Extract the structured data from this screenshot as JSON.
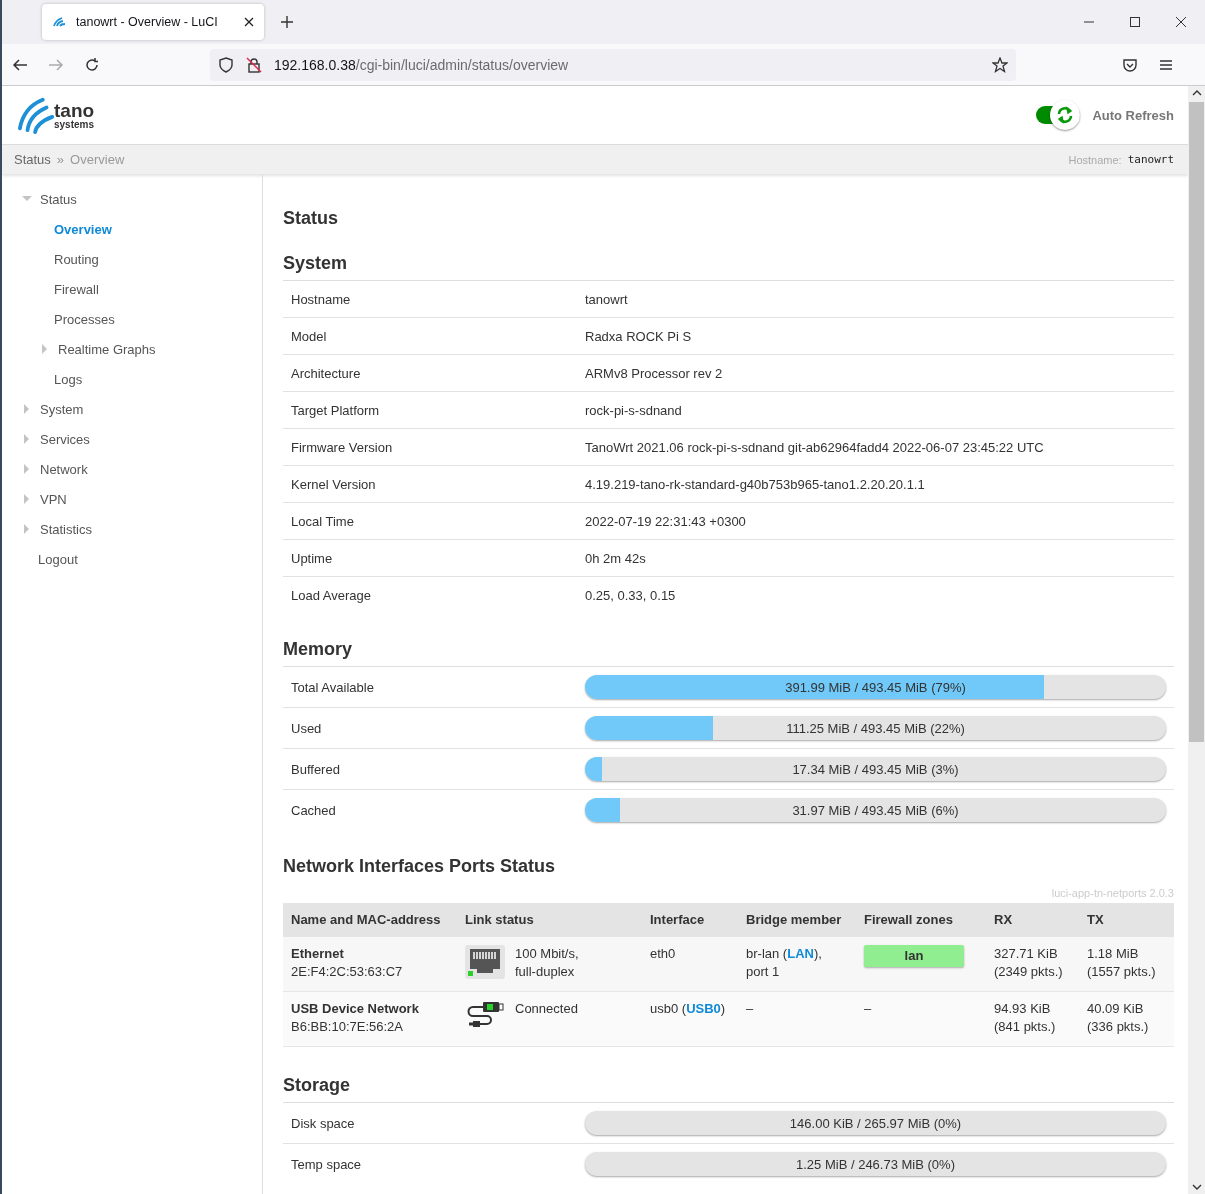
{
  "browser": {
    "tab_title": "tanowrt - Overview - LuCI",
    "url_host": "192.168.0.38",
    "url_path": "/cgi-bin/luci/admin/status/overview"
  },
  "header": {
    "logo_main": "tano",
    "logo_sub": "systems",
    "auto_refresh": {
      "label": "Auto Refresh",
      "on": true
    }
  },
  "breadcrumb": {
    "items": [
      "Status",
      "Overview"
    ],
    "separator": "»",
    "hostname_label": "Hostname:",
    "hostname": "tanowrt"
  },
  "sidebar": {
    "items": [
      {
        "label": "Status",
        "kind": "folder",
        "expanded": true,
        "selected": false,
        "children": [
          {
            "label": "Overview",
            "kind": "link",
            "selected": true
          },
          {
            "label": "Routing",
            "kind": "link",
            "selected": false
          },
          {
            "label": "Firewall",
            "kind": "link",
            "selected": false
          },
          {
            "label": "Processes",
            "kind": "link",
            "selected": false
          },
          {
            "label": "Realtime Graphs",
            "kind": "folder",
            "expanded": false,
            "selected": false
          },
          {
            "label": "Logs",
            "kind": "link",
            "selected": false
          }
        ]
      },
      {
        "label": "System",
        "kind": "folder",
        "expanded": false,
        "selected": false
      },
      {
        "label": "Services",
        "kind": "folder",
        "expanded": false,
        "selected": false
      },
      {
        "label": "Network",
        "kind": "folder",
        "expanded": false,
        "selected": false
      },
      {
        "label": "VPN",
        "kind": "folder",
        "expanded": false,
        "selected": false
      },
      {
        "label": "Statistics",
        "kind": "folder",
        "expanded": false,
        "selected": false
      },
      {
        "label": "Logout",
        "kind": "link",
        "selected": false
      }
    ]
  },
  "page_title": "Status",
  "system": {
    "title": "System",
    "rows": [
      {
        "label": "Hostname",
        "value": "tanowrt"
      },
      {
        "label": "Model",
        "value": "Radxa ROCK Pi S"
      },
      {
        "label": "Architecture",
        "value": "ARMv8 Processor rev 2"
      },
      {
        "label": "Target Platform",
        "value": "rock-pi-s-sdnand"
      },
      {
        "label": "Firmware Version",
        "value": "TanoWrt 2021.06 rock-pi-s-sdnand git-ab62964fadd4 2022-06-07 23:45:22 UTC"
      },
      {
        "label": "Kernel Version",
        "value": "4.19.219-tano-rk-standard-g40b753b965-tano1.2.20.20.1.1"
      },
      {
        "label": "Local Time",
        "value": "2022-07-19 22:31:43 +0300"
      },
      {
        "label": "Uptime",
        "value": "0h 2m 42s"
      },
      {
        "label": "Load Average",
        "value": "0.25, 0.33, 0.15"
      }
    ]
  },
  "memory": {
    "title": "Memory",
    "rows": [
      {
        "label": "Total Available",
        "reading": "391.99 MiB / 493.45 MiB (79%)",
        "level": 0.79
      },
      {
        "label": "Used",
        "reading": "111.25 MiB / 493.45 MiB (22%)",
        "level": 0.22
      },
      {
        "label": "Buffered",
        "reading": "17.34 MiB / 493.45 MiB (3%)",
        "level": 0.03
      },
      {
        "label": "Cached",
        "reading": "31.97 MiB / 493.45 MiB (6%)",
        "level": 0.06
      }
    ]
  },
  "ports": {
    "title": "Network Interfaces Ports Status",
    "version": "luci-app-tn-netports 2.0.3",
    "columns": [
      "Name and MAC-address",
      "Link status",
      "Interface",
      "Bridge member",
      "Firewall zones",
      "RX",
      "TX"
    ],
    "rows": [
      {
        "name": "Ethernet",
        "mac": "2E:F4:2C:53:63:C7",
        "kind": "ethernet",
        "link": [
          "100 Mbit/s,",
          "full-duplex"
        ],
        "interface": [
          {
            "text": "eth0",
            "kind": "plain"
          }
        ],
        "bridge": [
          [
            {
              "text": "br-lan (",
              "kind": "plain"
            },
            {
              "text": "LAN",
              "kind": "link"
            },
            {
              "text": "),",
              "kind": "plain"
            }
          ],
          [
            {
              "text": "port 1",
              "kind": "plain"
            }
          ]
        ],
        "zone": {
          "kind": "badge",
          "text": "lan",
          "color": "#90ee90"
        },
        "rx": [
          "327.71 KiB",
          "(2349 pkts.)"
        ],
        "tx": [
          "1.18 MiB",
          "(1557 pkts.)"
        ]
      },
      {
        "name": "USB Device Network",
        "mac": "B6:BB:10:7E:56:2A",
        "kind": "usb",
        "link": [
          "Connected"
        ],
        "interface": [
          {
            "text": "usb0 (",
            "kind": "plain"
          },
          {
            "text": "USB0",
            "kind": "link"
          },
          {
            "text": ")",
            "kind": "plain"
          }
        ],
        "bridge": [
          [
            {
              "text": "–",
              "kind": "plain"
            }
          ]
        ],
        "zone": {
          "kind": "text",
          "text": "–"
        },
        "rx": [
          "94.93 KiB",
          "(841 pkts.)"
        ],
        "tx": [
          "40.09 KiB",
          "(336 pkts.)"
        ]
      }
    ]
  },
  "storage": {
    "title": "Storage",
    "rows": [
      {
        "label": "Disk space",
        "reading": "146.00 KiB / 265.97 MiB (0%)"
      },
      {
        "label": "Temp space",
        "reading": "1.25 MiB / 246.73 MiB (0%)"
      }
    ]
  }
}
